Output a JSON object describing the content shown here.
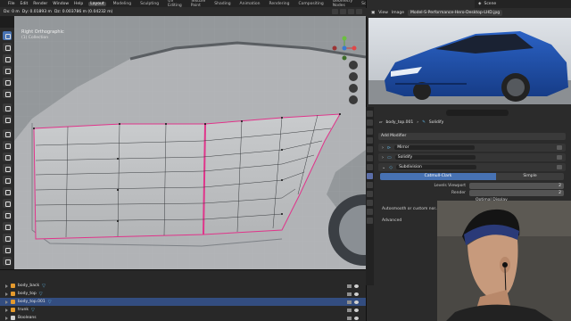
{
  "menubar": {
    "menus": [
      "File",
      "Edit",
      "Render",
      "Window",
      "Help"
    ],
    "workspaces": [
      "Layout",
      "Modeling",
      "Sculpting",
      "UV Editing",
      "Texture Paint",
      "Shading",
      "Animation",
      "Rendering",
      "Compositing",
      "Geometry Nodes",
      "Scripting"
    ],
    "active_workspace": "Layout",
    "scene_label": "Scene"
  },
  "viewport_header": {
    "dims": [
      "Dx: 0 m",
      "Dy: 0.01893 m",
      "Dz: 0.003786 m (0.04232 m)"
    ]
  },
  "viewport": {
    "view_name": "Right Orthographic",
    "view_sub": "(1) Collection"
  },
  "outliner": {
    "rows": [
      {
        "label": "body_back",
        "selected": false
      },
      {
        "label": "body_top",
        "selected": false
      },
      {
        "label": "body_top.001",
        "selected": true
      },
      {
        "label": "trunk",
        "selected": false
      },
      {
        "label": "Booleans",
        "selected": false
      }
    ]
  },
  "image_editor": {
    "menus": [
      "View",
      "Image"
    ],
    "filename": "Model-S-Performance-Hero-Desktop-LHD.jpg"
  },
  "properties": {
    "object_name": "body_top.001",
    "modifier_context": "Solidify",
    "add_modifier": "Add Modifier",
    "modifiers": [
      "Mirror",
      "Solidify",
      "Subdivision"
    ],
    "subdiv_types": [
      "Catmull-Clark",
      "Simple"
    ],
    "levels_viewport_label": "Levels Viewport",
    "levels_viewport": "2",
    "render_label": "Render",
    "render": "2",
    "optimal_display": "Optimal Display",
    "autosmooth": "Autosmooth or custom nor...",
    "advanced": "Advanced"
  },
  "colors": {
    "accent": "#4772b3",
    "selection": "#e0348a",
    "car_blue": "#1f4fa8",
    "blender_orange": "#e87d0d"
  }
}
